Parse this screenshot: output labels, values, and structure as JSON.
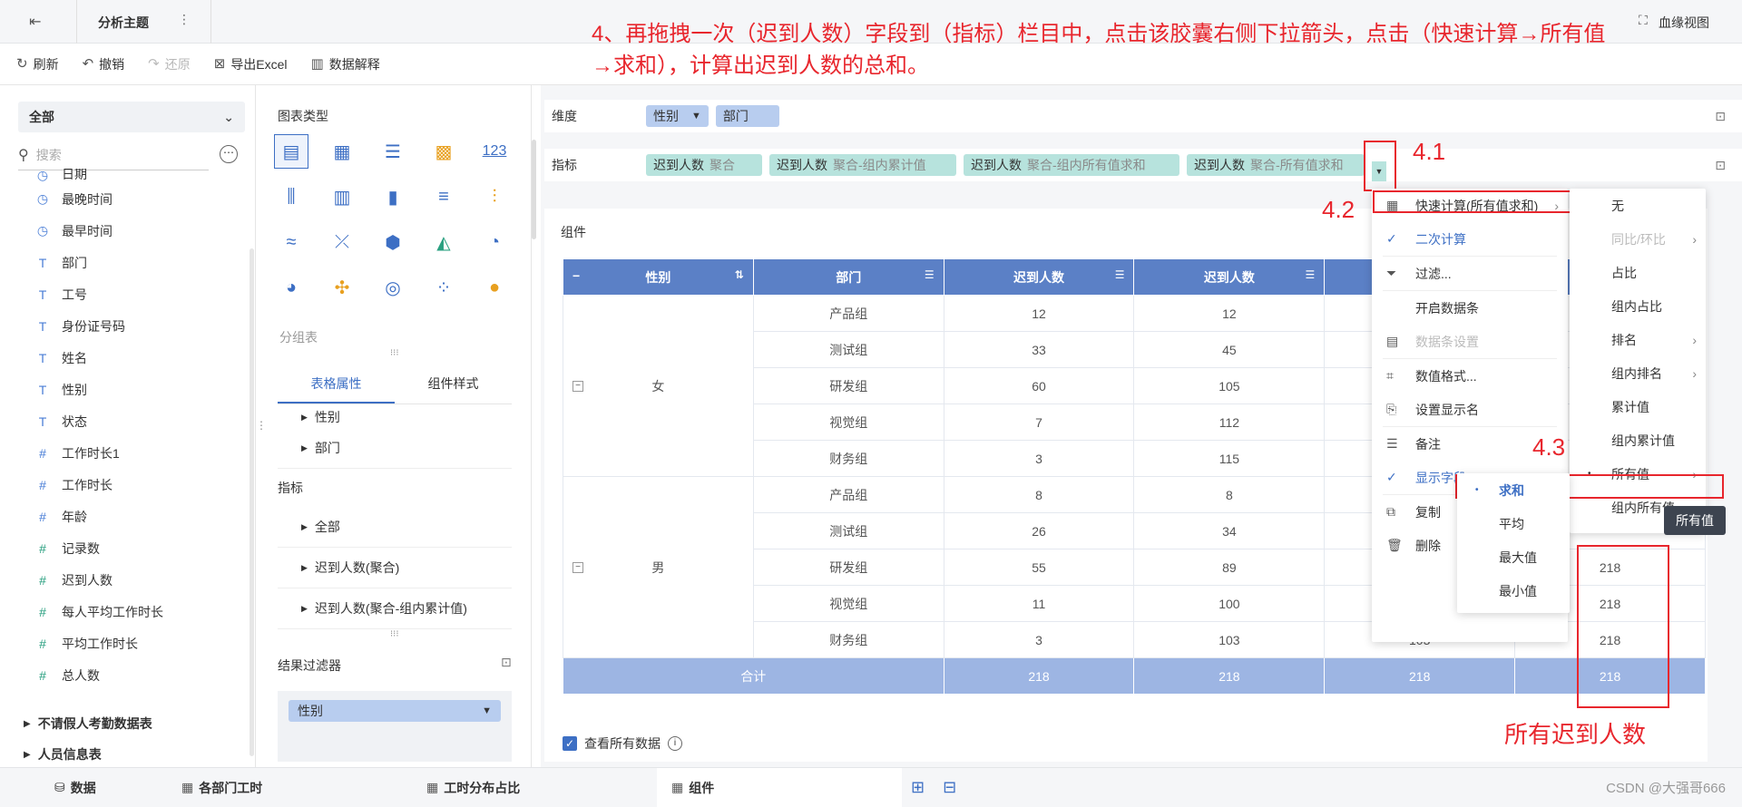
{
  "topbar": {
    "title": "分析主题",
    "right_label": "血缘视图"
  },
  "toolbar": {
    "refresh": "刷新",
    "undo": "撤销",
    "redo": "还原",
    "export": "导出Excel",
    "explain": "数据解释"
  },
  "annotation": {
    "instruction": "4、再拖拽一次（迟到人数）字段到（指标）栏目中，点击该胶囊右侧下拉箭头，点击（快速计算→所有值→求和），计算出迟到人数的总和。",
    "step1": "4.1",
    "step2": "4.2",
    "step3": "4.3",
    "note": "所有迟到人数"
  },
  "left": {
    "dropdown": "全部",
    "search_placeholder": "搜索",
    "fields": [
      {
        "icon": "clock",
        "label": "日期"
      },
      {
        "icon": "clock",
        "label": "最晚时间"
      },
      {
        "icon": "clock",
        "label": "最早时间"
      },
      {
        "icon": "T",
        "label": "部门"
      },
      {
        "icon": "T",
        "label": "工号"
      },
      {
        "icon": "T",
        "label": "身份证号码"
      },
      {
        "icon": "T",
        "label": "姓名"
      },
      {
        "icon": "T",
        "label": "性别"
      },
      {
        "icon": "T",
        "label": "状态"
      },
      {
        "icon": "#",
        "label": "工作时长1"
      },
      {
        "icon": "#",
        "label": "工作时长"
      },
      {
        "icon": "#",
        "label": "年龄"
      },
      {
        "icon": "#f",
        "label": "记录数"
      },
      {
        "icon": "#f",
        "label": "迟到人数"
      },
      {
        "icon": "#f",
        "label": "每人平均工作时长"
      },
      {
        "icon": "#f",
        "label": "平均工作时长"
      },
      {
        "icon": "#f",
        "label": "总人数"
      }
    ],
    "groups": [
      "不请假人考勤数据表",
      "人员信息表"
    ]
  },
  "mid": {
    "chart_type_title": "图表类型",
    "group_table_label": "分组表",
    "tabs": [
      "表格属性",
      "组件样式"
    ],
    "dim_items": [
      "性别",
      "部门"
    ],
    "metric_header": "指标",
    "metric_items": [
      "全部",
      "迟到人数(聚合)",
      "迟到人数(聚合-组内累计值)"
    ],
    "filter_title": "结果过滤器",
    "filter_pill": "性别"
  },
  "main": {
    "dim_label": "维度",
    "metric_label": "指标",
    "dim_pills": [
      "性别",
      "部门"
    ],
    "metric_pills": [
      {
        "name": "迟到人数",
        "sub": "聚合"
      },
      {
        "name": "迟到人数",
        "sub": "聚合-组内累计值"
      },
      {
        "name": "迟到人数",
        "sub": "聚合-组内所有值求和"
      },
      {
        "name": "迟到人数",
        "sub": "聚合-所有值求和"
      }
    ],
    "component_label": "组件",
    "table": {
      "headers": [
        "性别",
        "部门",
        "迟到人数",
        "迟到人数"
      ],
      "groups": [
        {
          "gender": "女",
          "rows": [
            {
              "dept": "产品组",
              "c1": "12",
              "c2": "12"
            },
            {
              "dept": "测试组",
              "c1": "33",
              "c2": "45"
            },
            {
              "dept": "研发组",
              "c1": "60",
              "c2": "105"
            },
            {
              "dept": "视觉组",
              "c1": "7",
              "c2": "112"
            },
            {
              "dept": "财务组",
              "c1": "3",
              "c2": "115"
            }
          ]
        },
        {
          "gender": "男",
          "rows": [
            {
              "dept": "产品组",
              "c1": "8",
              "c2": "8"
            },
            {
              "dept": "测试组",
              "c1": "26",
              "c2": "34"
            },
            {
              "dept": "研发组",
              "c1": "55",
              "c2": "89",
              "c4": "218"
            },
            {
              "dept": "视觉组",
              "c1": "11",
              "c2": "100",
              "c4": "218"
            },
            {
              "dept": "财务组",
              "c1": "3",
              "c2": "103",
              "c3": "103",
              "c4": "218"
            }
          ]
        }
      ],
      "total": {
        "label": "合计",
        "c1": "218",
        "c2": "218",
        "c3": "218",
        "c4": "218"
      }
    },
    "show_all_data": "查看所有数据"
  },
  "menu1": {
    "items": [
      {
        "icon": "calc",
        "label": "快速计算(所有值求和)",
        "arrow": true
      },
      {
        "icon": "check",
        "label": "二次计算",
        "blue": true
      },
      {
        "icon": "filter",
        "label": "过滤..."
      },
      {
        "icon": "",
        "label": "开启数据条"
      },
      {
        "icon": "bars",
        "label": "数据条设置",
        "dis": true
      },
      {
        "icon": "format",
        "label": "数值格式..."
      },
      {
        "icon": "rename",
        "label": "设置显示名"
      },
      {
        "icon": "note",
        "label": "备注"
      },
      {
        "icon": "check",
        "label": "显示字段",
        "blue": true
      },
      {
        "icon": "copy",
        "label": "复制"
      },
      {
        "icon": "trash",
        "label": "删除"
      }
    ]
  },
  "menu2": {
    "items": [
      "无",
      "同比/环比",
      "占比",
      "组内占比",
      "排名",
      "组内排名",
      "累计值",
      "组内累计值",
      "所有值",
      "组内所有值"
    ]
  },
  "menu3": {
    "items": [
      "求和",
      "平均",
      "最大值",
      "最小值"
    ]
  },
  "tooltip": "所有值",
  "bottom": {
    "tabs": [
      "数据",
      "各部门工时",
      "工时分布占比",
      "组件"
    ]
  },
  "watermark": "CSDN @大强哥666"
}
